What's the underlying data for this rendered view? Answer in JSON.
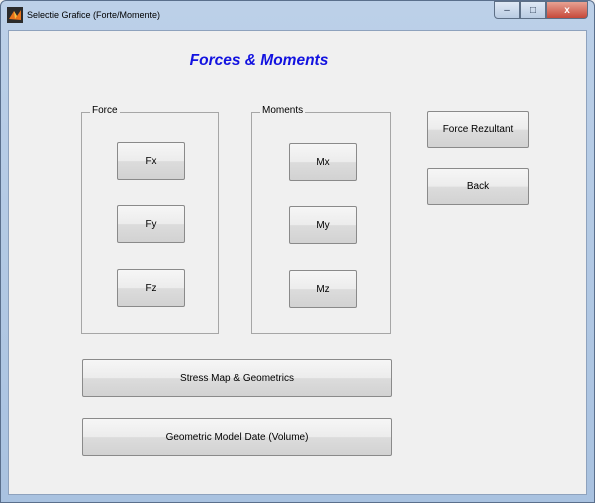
{
  "window": {
    "title": "Selectie Grafice (Forte/Momente)",
    "controls": {
      "minimize": "–",
      "maximize": "□",
      "close": "x"
    }
  },
  "heading": "Forces & Moments",
  "force_panel": {
    "label": "Force",
    "buttons": [
      "Fx",
      "Fy",
      "Fz"
    ]
  },
  "moments_panel": {
    "label": "Moments",
    "buttons": [
      "Mx",
      "My",
      "Mz"
    ]
  },
  "side_buttons": {
    "force_rezultant": "Force Rezultant",
    "back": "Back"
  },
  "bottom_buttons": {
    "stress_map": "Stress Map & Geometrics",
    "geometric_model": "Geometric Model  Date (Volume)"
  },
  "colors": {
    "heading": "#1212e0",
    "background": "#f0f0f0"
  }
}
